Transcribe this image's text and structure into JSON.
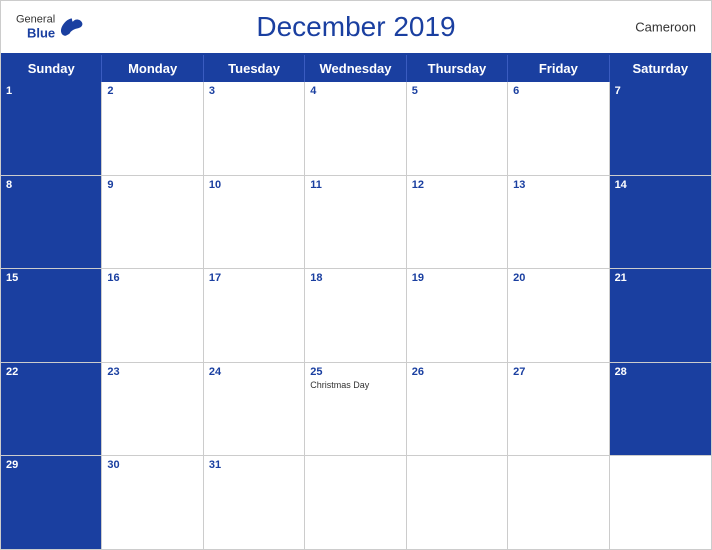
{
  "header": {
    "logo": {
      "general": "General",
      "blue": "Blue"
    },
    "title": "December 2019",
    "country": "Cameroon"
  },
  "dayHeaders": [
    "Sunday",
    "Monday",
    "Tuesday",
    "Wednesday",
    "Thursday",
    "Friday",
    "Saturday"
  ],
  "weeks": [
    [
      {
        "num": "1",
        "holiday": "",
        "type": "sunday"
      },
      {
        "num": "2",
        "holiday": "",
        "type": "weekday"
      },
      {
        "num": "3",
        "holiday": "",
        "type": "weekday"
      },
      {
        "num": "4",
        "holiday": "",
        "type": "weekday"
      },
      {
        "num": "5",
        "holiday": "",
        "type": "weekday"
      },
      {
        "num": "6",
        "holiday": "",
        "type": "weekday"
      },
      {
        "num": "7",
        "holiday": "",
        "type": "saturday"
      }
    ],
    [
      {
        "num": "8",
        "holiday": "",
        "type": "sunday"
      },
      {
        "num": "9",
        "holiday": "",
        "type": "weekday"
      },
      {
        "num": "10",
        "holiday": "",
        "type": "weekday"
      },
      {
        "num": "11",
        "holiday": "",
        "type": "weekday"
      },
      {
        "num": "12",
        "holiday": "",
        "type": "weekday"
      },
      {
        "num": "13",
        "holiday": "",
        "type": "weekday"
      },
      {
        "num": "14",
        "holiday": "",
        "type": "saturday"
      }
    ],
    [
      {
        "num": "15",
        "holiday": "",
        "type": "sunday"
      },
      {
        "num": "16",
        "holiday": "",
        "type": "weekday"
      },
      {
        "num": "17",
        "holiday": "",
        "type": "weekday"
      },
      {
        "num": "18",
        "holiday": "",
        "type": "weekday"
      },
      {
        "num": "19",
        "holiday": "",
        "type": "weekday"
      },
      {
        "num": "20",
        "holiday": "",
        "type": "weekday"
      },
      {
        "num": "21",
        "holiday": "",
        "type": "saturday"
      }
    ],
    [
      {
        "num": "22",
        "holiday": "",
        "type": "sunday"
      },
      {
        "num": "23",
        "holiday": "",
        "type": "weekday"
      },
      {
        "num": "24",
        "holiday": "",
        "type": "weekday"
      },
      {
        "num": "25",
        "holiday": "Christmas Day",
        "type": "weekday"
      },
      {
        "num": "26",
        "holiday": "",
        "type": "weekday"
      },
      {
        "num": "27",
        "holiday": "",
        "type": "weekday"
      },
      {
        "num": "28",
        "holiday": "",
        "type": "saturday"
      }
    ],
    [
      {
        "num": "29",
        "holiday": "",
        "type": "sunday"
      },
      {
        "num": "30",
        "holiday": "",
        "type": "weekday"
      },
      {
        "num": "31",
        "holiday": "",
        "type": "weekday"
      },
      {
        "num": "",
        "holiday": "",
        "type": "empty"
      },
      {
        "num": "",
        "holiday": "",
        "type": "empty"
      },
      {
        "num": "",
        "holiday": "",
        "type": "empty"
      },
      {
        "num": "",
        "holiday": "",
        "type": "empty"
      }
    ]
  ]
}
